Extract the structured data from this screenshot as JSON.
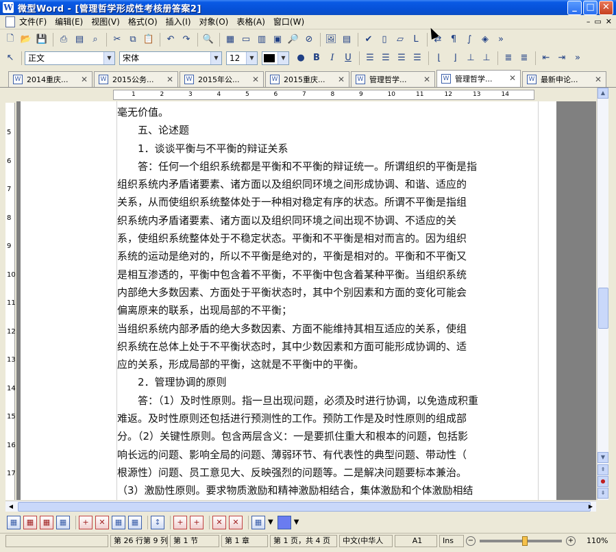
{
  "window": {
    "title": "微型Word - [管理哲学形成性考核册答案2]",
    "minimize": "_",
    "maximize": "□",
    "close": "✕"
  },
  "menu": {
    "items": [
      "文件(F)",
      "编辑(E)",
      "视图(V)",
      "格式(O)",
      "插入(I)",
      "对象(O)",
      "表格(A)",
      "窗口(W)"
    ],
    "right_controls": [
      "–",
      "▭",
      "✕"
    ]
  },
  "format_toolbar": {
    "style_value": "正文",
    "font_value": "宋体",
    "size_value": "12",
    "bold": "B",
    "italic": "I",
    "underline": "U"
  },
  "tabs": [
    {
      "label": "2014重庆..."
    },
    {
      "label": "2015公务..."
    },
    {
      "label": "2015年公..."
    },
    {
      "label": "2015重庆..."
    },
    {
      "label": "管理哲学..."
    },
    {
      "label": "管理哲学..."
    },
    {
      "label": "最新申论..."
    }
  ],
  "ruler_numbers": [
    "1",
    "2",
    "3",
    "4",
    "5",
    "6",
    "7",
    "8",
    "9",
    "10",
    "11",
    "12",
    "13",
    "14"
  ],
  "vertical_ruler_numbers": [
    "5",
    "6",
    "7",
    "8",
    "9",
    "10",
    "11",
    "12",
    "13",
    "14",
    "15",
    "16",
    "17"
  ],
  "document": {
    "lines": [
      "毫无价值。",
      "　　五、论述题",
      "　　1．谈谈平衡与不平衡的辩证关系",
      "　　答：任何一个组织系统都是平衡和不平衡的辩证统一。所谓组织的平衡是指",
      "组织系统内矛盾诸要素、诸方面以及组织同环境之间形成协调、和谐、适应的",
      "关系，从而使组织系统整体处于一种相对稳定有序的状态。所谓不平衡是指组",
      "织系统内矛盾诸要素、诸方面以及组织同环境之间出现不协调、不适应的关",
      "系，使组织系统整体处于不稳定状态。平衡和不平衡是相对而言的。因为组织",
      "系统的运动是绝对的，所以不平衡是绝对的，平衡是相对的。平衡和不平衡又",
      "是相互渗透的，平衡中包含着不平衡，不平衡中包含着某种平衡。当组织系统",
      "内部绝大多数因素、方面处于平衡状态时，其中个别因素和方面的变化可能会",
      "偏离原来的联系，出现局部的不平衡；",
      "当组织系统内部矛盾的绝大多数因素、方面不能维持其相互适应的关系，使组",
      "织系统在总体上处于不平衡状态时，其中少数因素和方面可能形成协调的、适",
      "应的关系，形成局部的平衡，这就是不平衡中的平衡。",
      "　　2．管理协调的原则",
      "　　答：（1）及时性原则。指一旦出现问题，必须及时进行协调，以免造成积重",
      "难返。及时性原则还包括进行预测性的工作。预防工作是及时性原则的组成部",
      "分。（2）关键性原则。包含两层含义：一是要抓住重大和根本的问题，包括影",
      "响长远的问题、影响全局的问题、薄弱环节、有代表性的典型问题、带动性（",
      "根源性）问题、员工意见大、反映强烈的问题等。二是解决问题要标本兼治。",
      "（3）激励性原则。要求物质激励和精神激励相结合，集体激励和个体激励相结"
    ]
  },
  "status": {
    "position": "第 26 行第 9 列",
    "section": "第 1 节",
    "chapter": "第 1 章",
    "pages": "第 1 页，共 4 页",
    "language": "中文(中华人",
    "cell": "A1",
    "mode": "Ins",
    "zoom": "110%",
    "zoom_fraction": 0.55
  }
}
